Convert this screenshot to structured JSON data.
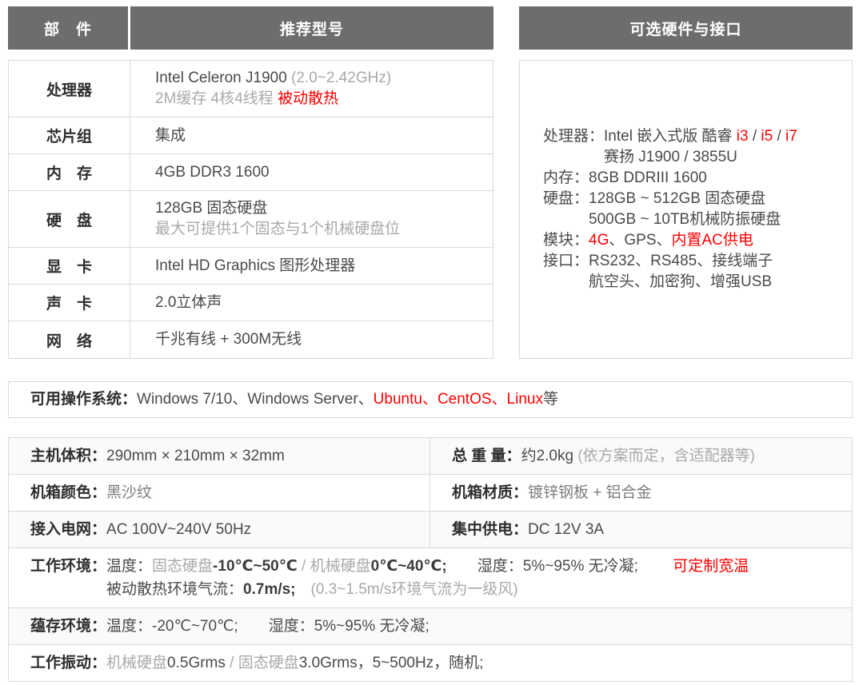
{
  "colors": {
    "header_bg": "#6d6d6d",
    "header_text": "#ffffff",
    "border": "#d9d9d9",
    "text": "#4a4a4a",
    "label": "#2e2e2e",
    "muted": "#a9a9a9",
    "gray_value": "#7d7d7d",
    "red": "#ff0000",
    "stripe": "#fafafa"
  },
  "left_table": {
    "header": {
      "parts": "部　件",
      "model": "推荐型号"
    },
    "rows": [
      {
        "name": "cpu",
        "label": "处理器",
        "lines": [
          [
            [
              "Intel Celeron J1900 ",
              "n"
            ],
            [
              "(2.0~2.42GHz)",
              "m"
            ]
          ],
          [
            [
              "2M缓存 4核4线程 ",
              "m"
            ],
            [
              "被动散热",
              "r"
            ]
          ]
        ]
      },
      {
        "name": "chipset",
        "label": "芯片组",
        "lines": [
          [
            [
              "集成",
              "n"
            ]
          ]
        ]
      },
      {
        "name": "memory",
        "label": "内　存",
        "lines": [
          [
            [
              "4GB DDR3 1600",
              "n"
            ]
          ]
        ]
      },
      {
        "name": "storage",
        "label": "硬　盘",
        "lines": [
          [
            [
              "128GB 固态硬盘",
              "n"
            ]
          ],
          [
            [
              "最大可提供1个固态与1个机械硬盘位",
              "m"
            ]
          ]
        ]
      },
      {
        "name": "graphics",
        "label": "显　卡",
        "lines": [
          [
            [
              "Intel HD Graphics 图形处理器",
              "n"
            ]
          ]
        ]
      },
      {
        "name": "audio",
        "label": "声　卡",
        "lines": [
          [
            [
              "2.0立体声",
              "n"
            ]
          ]
        ]
      },
      {
        "name": "network",
        "label": "网　络",
        "lines": [
          [
            [
              "千兆有线 + 300M无线",
              "n"
            ]
          ]
        ]
      }
    ]
  },
  "right_panel": {
    "header": "可选硬件与接口",
    "entries": [
      {
        "name": "cpu-options",
        "label": "处理器：",
        "lines": [
          [
            [
              "Intel 嵌入式版 酷睿 ",
              "n"
            ],
            [
              "i3",
              "r"
            ],
            [
              " / ",
              "n"
            ],
            [
              "i5",
              "r"
            ],
            [
              " / ",
              "n"
            ],
            [
              "i7",
              "r"
            ]
          ],
          [
            [
              "赛扬 J1900 / 3855U",
              "n"
            ]
          ]
        ]
      },
      {
        "name": "memory-options",
        "label": "内存：",
        "lines": [
          [
            [
              "8GB DDRIII 1600",
              "n"
            ]
          ]
        ]
      },
      {
        "name": "storage-options",
        "label": "硬盘：",
        "lines": [
          [
            [
              "128GB ~ 512GB 固态硬盘",
              "n"
            ]
          ],
          [
            [
              "500GB ~ 10TB机械防振硬盘",
              "n"
            ]
          ]
        ]
      },
      {
        "name": "module-options",
        "label": "模块：",
        "lines": [
          [
            [
              "4G",
              "r"
            ],
            [
              "、GPS、",
              "n"
            ],
            [
              "内置AC供电",
              "r"
            ]
          ]
        ]
      },
      {
        "name": "port-options",
        "label": "接口：",
        "lines": [
          [
            [
              "RS232、RS485、接线端子",
              "n"
            ]
          ],
          [
            [
              "航空头、加密狗、增强USB",
              "n"
            ]
          ]
        ]
      }
    ]
  },
  "os_bar": {
    "label": "可用操作系统：",
    "segments": [
      [
        "Windows 7/10、Windows Server、",
        "n"
      ],
      [
        "Ubuntu、CentOS、Linux",
        "r"
      ],
      [
        "等",
        "n"
      ]
    ]
  },
  "bottom_table": {
    "rows": [
      {
        "name": "dimensions-weight",
        "striped": true,
        "cells": [
          {
            "name": "host-dimensions",
            "label": "主机体积：",
            "lines": [
              [
                [
                  "290mm × 210mm × 32mm",
                  "n"
                ]
              ]
            ]
          },
          {
            "name": "total-weight",
            "label": "总 重 量：",
            "lines": [
              [
                [
                  "约2.0kg ",
                  "n"
                ],
                [
                  "(依方案而定，含适配器等)",
                  "m"
                ]
              ]
            ]
          }
        ]
      },
      {
        "name": "color-material",
        "striped": false,
        "cells": [
          {
            "name": "chassis-color",
            "label": "机箱颜色：",
            "lines": [
              [
                [
                  "黑沙纹",
                  "g"
                ]
              ]
            ]
          },
          {
            "name": "chassis-material",
            "label": "机箱材质：",
            "lines": [
              [
                [
                  "镀锌钢板 + 铝合金",
                  "g"
                ]
              ]
            ]
          }
        ]
      },
      {
        "name": "power-input",
        "striped": true,
        "cells": [
          {
            "name": "ac-power",
            "label": "接入电网：",
            "lines": [
              [
                [
                  "AC 100V~240V 50Hz",
                  "n"
                ]
              ]
            ]
          },
          {
            "name": "dc-power",
            "label": "集中供电：",
            "lines": [
              [
                [
                  "DC 12V 3A",
                  "n"
                ]
              ]
            ]
          }
        ]
      },
      {
        "name": "operating-environment",
        "striped": false,
        "cells": [
          {
            "name": "operating-environment",
            "label": "工作环境：",
            "lines": [
              [
                [
                  "温度：",
                  "n"
                ],
                [
                  "固态硬盘",
                  "m"
                ],
                [
                  "-10℃~50℃",
                  "d"
                ],
                [
                  " / ",
                  "m"
                ],
                [
                  "机械硬盘",
                  "m"
                ],
                [
                  "0℃~40℃;",
                  "d"
                ],
                [
                  "　　",
                  "n"
                ],
                [
                  "湿度：5%~95% 无冷凝;",
                  "n"
                ],
                [
                  "　　 ",
                  "n"
                ],
                [
                  "可定制宽温",
                  "r"
                ]
              ],
              [
                [
                  "被动散热环境气流：",
                  "n"
                ],
                [
                  "0.7m/s;",
                  "d"
                ],
                [
                  "　",
                  "n"
                ],
                [
                  "(0.3~1.5m/s环境气流为一级风)",
                  "m"
                ]
              ]
            ]
          }
        ]
      },
      {
        "name": "storage-environment",
        "striped": true,
        "cells": [
          {
            "name": "storage-environment",
            "label": "蕴存环境：",
            "lines": [
              [
                [
                  "温度：-20℃~70℃;",
                  "n"
                ],
                [
                  "　　",
                  "n"
                ],
                [
                  "湿度：5%~95% 无冷凝;",
                  "n"
                ]
              ]
            ]
          }
        ]
      },
      {
        "name": "operating-vibration",
        "striped": false,
        "cells": [
          {
            "name": "operating-vibration",
            "label": "工作振动：",
            "lines": [
              [
                [
                  "机械硬盘",
                  "m"
                ],
                [
                  "0.5Grms",
                  "n"
                ],
                [
                  " / ",
                  "m"
                ],
                [
                  "固态硬盘",
                  "m"
                ],
                [
                  "3.0Grms，5~500Hz，随机;",
                  "n"
                ]
              ]
            ]
          }
        ]
      }
    ]
  }
}
